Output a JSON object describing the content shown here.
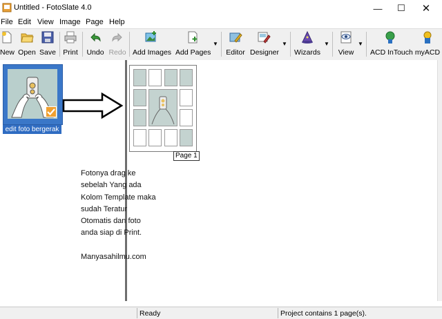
{
  "window": {
    "title": "Untitled - FotoSlate 4.0"
  },
  "menu": {
    "items": [
      "File",
      "Edit",
      "View",
      "Image",
      "Page",
      "Help"
    ]
  },
  "toolbar": {
    "new": "New",
    "open": "Open",
    "save": "Save",
    "print": "Print",
    "undo": "Undo",
    "redo": "Redo",
    "add_images": "Add Images",
    "add_pages": "Add Pages",
    "editor": "Editor",
    "designer": "Designer",
    "wizards": "Wizards",
    "view": "View",
    "acd_intouch": "ACD InTouch",
    "myacd": "myACD"
  },
  "left_pane": {
    "thumbnail_label": "edit foto bergerak"
  },
  "page_preview": {
    "label": "Page 1"
  },
  "note": {
    "lines": [
      "Fotonya drag ke",
      "sebelah Yang ada",
      "Kolom Template maka",
      "sudah Teratur",
      "Otomatis dan foto",
      "anda siap di Print.",
      "",
      "Manyasahilmu.com"
    ]
  },
  "status": {
    "left": "Ready",
    "right": "Project contains 1 page(s)."
  },
  "colors": {
    "selection": "#3a77c8",
    "splitter": "#6e6e6e",
    "toolbar_bg": "#f0f0f0"
  }
}
